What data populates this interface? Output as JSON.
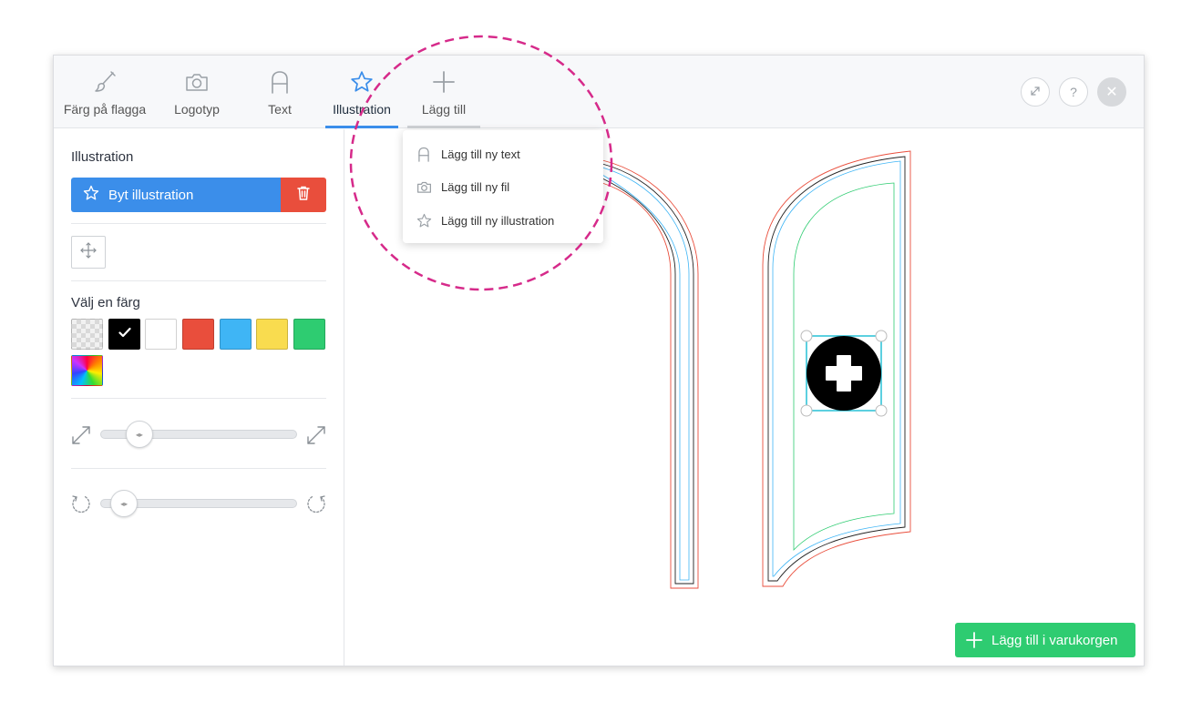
{
  "toolbar": {
    "tabs": [
      {
        "label": "Färg på flagga",
        "icon": "brush-icon"
      },
      {
        "label": "Logotyp",
        "icon": "camera-icon"
      },
      {
        "label": "Text",
        "icon": "text-a-icon"
      },
      {
        "label": "Illustration",
        "icon": "star-icon",
        "active": true
      },
      {
        "label": "Lägg till",
        "icon": "plus-icon"
      }
    ],
    "right_buttons": [
      "expand-icon",
      "help-icon",
      "close-icon"
    ],
    "help_label": "?",
    "close_label": "✕"
  },
  "sidebar": {
    "illustration_title": "Illustration",
    "change_button": "Byt illustration",
    "color_title": "Välj en färg",
    "colors": [
      "transparent",
      "#000000",
      "#ffffff",
      "#e94e3c",
      "#3fb5f5",
      "#f9dc4f",
      "#2ecc71",
      "rainbow"
    ],
    "selected_color": "#000000",
    "size_slider_value": 0.15,
    "rotate_slider_value": 0.06
  },
  "dropdown": {
    "items": [
      {
        "label": "Lägg till ny text",
        "icon": "text-a-icon"
      },
      {
        "label": "Lägg till ny fil",
        "icon": "camera-icon"
      },
      {
        "label": "Lägg till ny illustration",
        "icon": "star-icon"
      }
    ]
  },
  "cart_button": "Lägg till i varukorgen",
  "colors": {
    "accent_blue": "#3b8eea",
    "delete_red": "#e94e3c",
    "cart_green": "#2ecc71",
    "highlight_magenta": "#d62a8a"
  }
}
